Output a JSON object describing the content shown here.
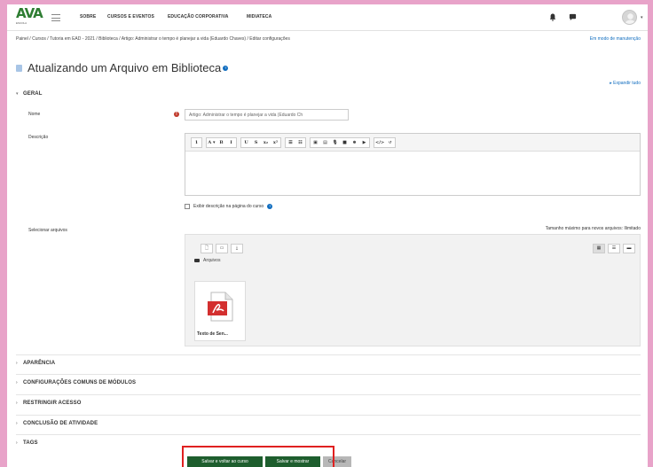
{
  "navbar": {
    "logo_main": "AVA",
    "logo_sub": "ESCOLA",
    "links": [
      "SOBRE",
      "CURSOS E EVENTOS",
      "EDUCAÇÃO CORPORATIVA",
      "MIDIATECA"
    ]
  },
  "breadcrumb": {
    "items": [
      "Painel",
      "Cursos",
      "Tutoria em EAD - 2021",
      "Biblioteca",
      "Artigo: Administrar o tempo é planejar a vida (Eduardo Chaves)",
      "Editar configurações"
    ],
    "separator": " / "
  },
  "maintenance_label": "Em modo de manutenção",
  "page": {
    "title": "Atualizando um Arquivo em Biblioteca",
    "expand_all": "Expandir tudo"
  },
  "general": {
    "header": "GERAL",
    "name_label": "Nome",
    "name_value": "Artigo: Administrar o tempo é planejar a vida (Eduardo Ch",
    "description_label": "Descrição",
    "show_description_label": "Exibir descrição na página do curso",
    "select_files_label": "Selecionar arquivos",
    "max_size_label": "Tamanho máximo para novos arquivos: Ilimitado"
  },
  "editor_toolbar": {
    "groups": [
      [
        "1"
      ],
      [
        "A ▾",
        "B",
        "I"
      ],
      [
        "U",
        "S",
        "x₂",
        "x²"
      ],
      [
        "☰",
        "☷"
      ],
      [
        "▣",
        "▤",
        "🎙",
        "■",
        "⊕",
        "▶"
      ],
      [
        "</>",
        "↺"
      ]
    ]
  },
  "filemanager": {
    "path": "Arquivos",
    "files": [
      {
        "name": "Texto de Sen..."
      }
    ]
  },
  "sections": [
    "APARÊNCIA",
    "CONFIGURAÇÕES COMUNS DE MÓDULOS",
    "RESTRINGIR ACESSO",
    "CONCLUSÃO DE ATIVIDADE",
    "TAGS"
  ],
  "buttons": {
    "save_return": "Salvar e voltar ao curso",
    "save_show": "Salvar e mostrar",
    "cancel": "Cancelar"
  },
  "colors": {
    "accent": "#0f6cbf",
    "primary_button": "#1e5e2e",
    "required": "#c0392b",
    "highlight": "#e02020",
    "frame": "#e8a3c9"
  }
}
